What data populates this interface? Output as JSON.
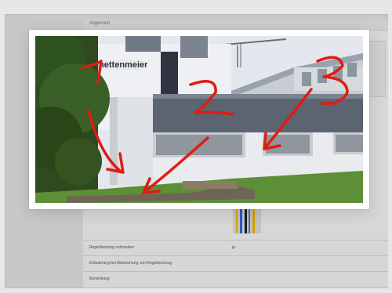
{
  "background": {
    "header_text": "Allgemein",
    "rows": [
      {
        "label": "Regeldeckung vorhanden",
        "value": "ja"
      },
      {
        "label": "Erläuterung bei Abweichung von Regeldeckung",
        "value": ""
      },
      {
        "label": "Bemerkung",
        "value": ""
      }
    ]
  },
  "modal": {
    "photo": {
      "building_sign": "mettenmeier",
      "annotations": [
        "1",
        "2",
        "3"
      ]
    }
  }
}
